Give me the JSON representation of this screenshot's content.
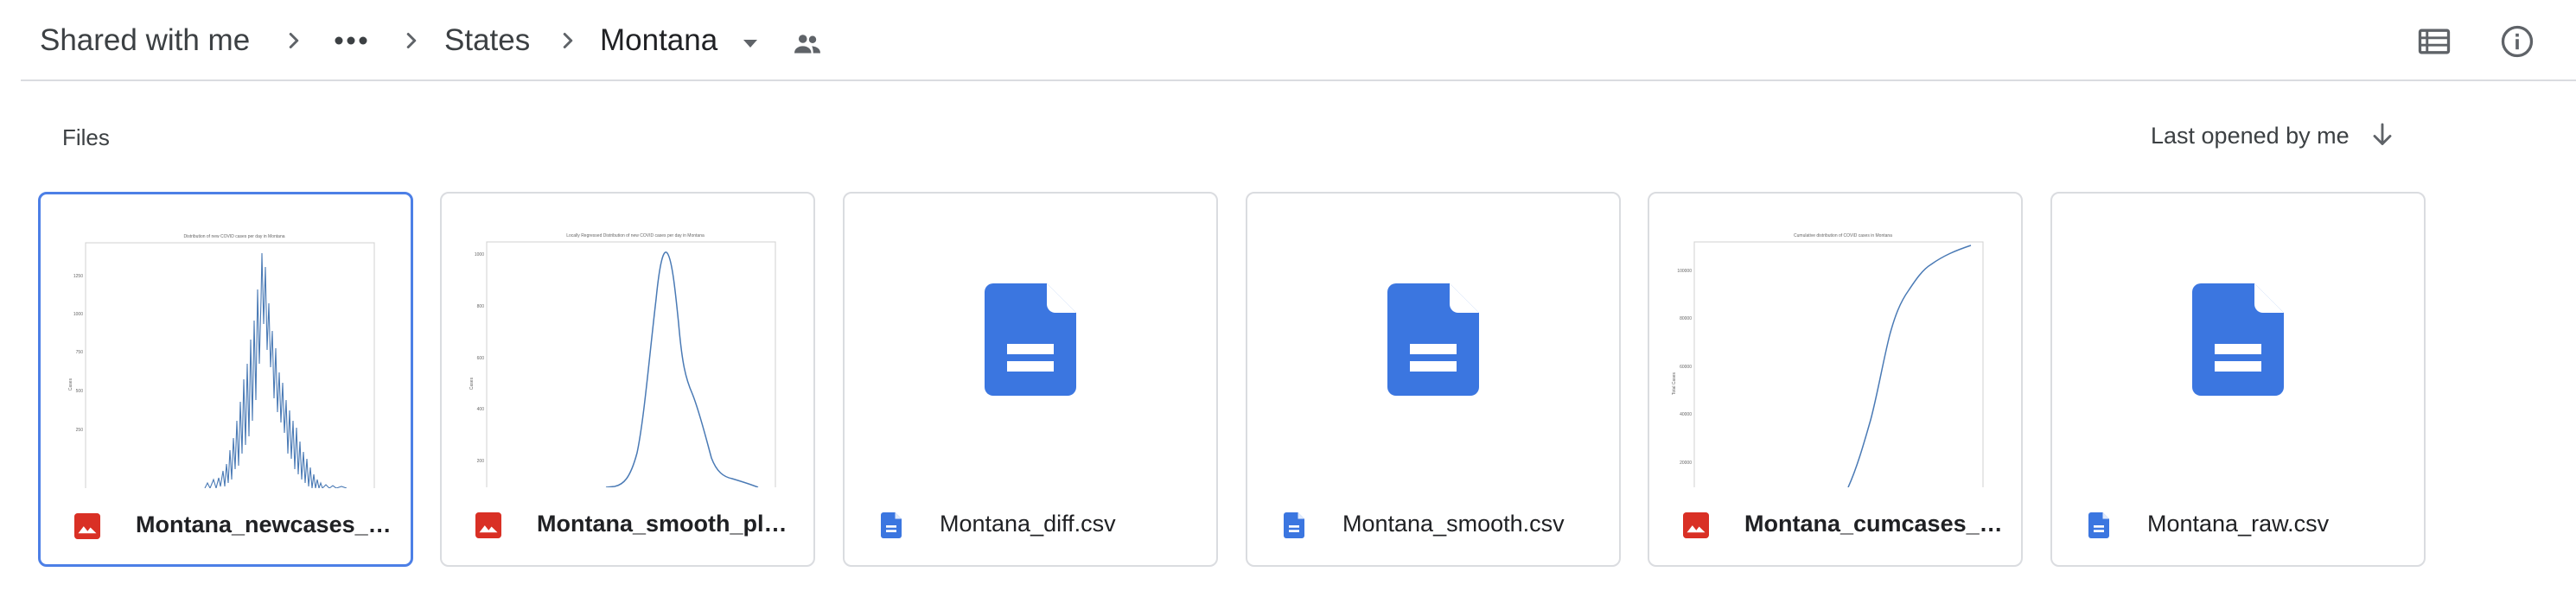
{
  "breadcrumb": {
    "root": "Shared with me",
    "more": "•••",
    "folder": "States",
    "current": "Montana"
  },
  "icons": {
    "chevron": "chevron-right-icon",
    "more": "more-horiz-icon",
    "dropdown": "arrow-drop-down-icon",
    "shared": "people-icon",
    "list_view": "list-view-icon",
    "details": "info-icon",
    "sort_direction": "arrow-downward-icon"
  },
  "section": {
    "files_label": "Files",
    "sort_label": "Last opened by me"
  },
  "colors": {
    "image_icon": "#d93025",
    "doc_icon": "#3b76e0",
    "selected_border": "#4c7fe6",
    "plot_line": "#4a7ab5"
  },
  "files": [
    {
      "name": "Montana_newcases_plo...",
      "type": "image",
      "preview_title": "Distribution of new COVID cases per day in Montana",
      "ylabel": "Cases"
    },
    {
      "name": "Montana_smooth_plot....",
      "type": "image",
      "preview_title": "Locally Regressed Distribution of new COVID cases per day in Montana",
      "ylabel": "Cases"
    },
    {
      "name": "Montana_diff.csv",
      "type": "csv"
    },
    {
      "name": "Montana_smooth.csv",
      "type": "csv"
    },
    {
      "name": "Montana_cumcases_pl...",
      "type": "image",
      "preview_title": "Cumulative distribution of COVID cases in Montana",
      "ylabel": "Total Cases"
    },
    {
      "name": "Montana_raw.csv",
      "type": "csv"
    }
  ]
}
